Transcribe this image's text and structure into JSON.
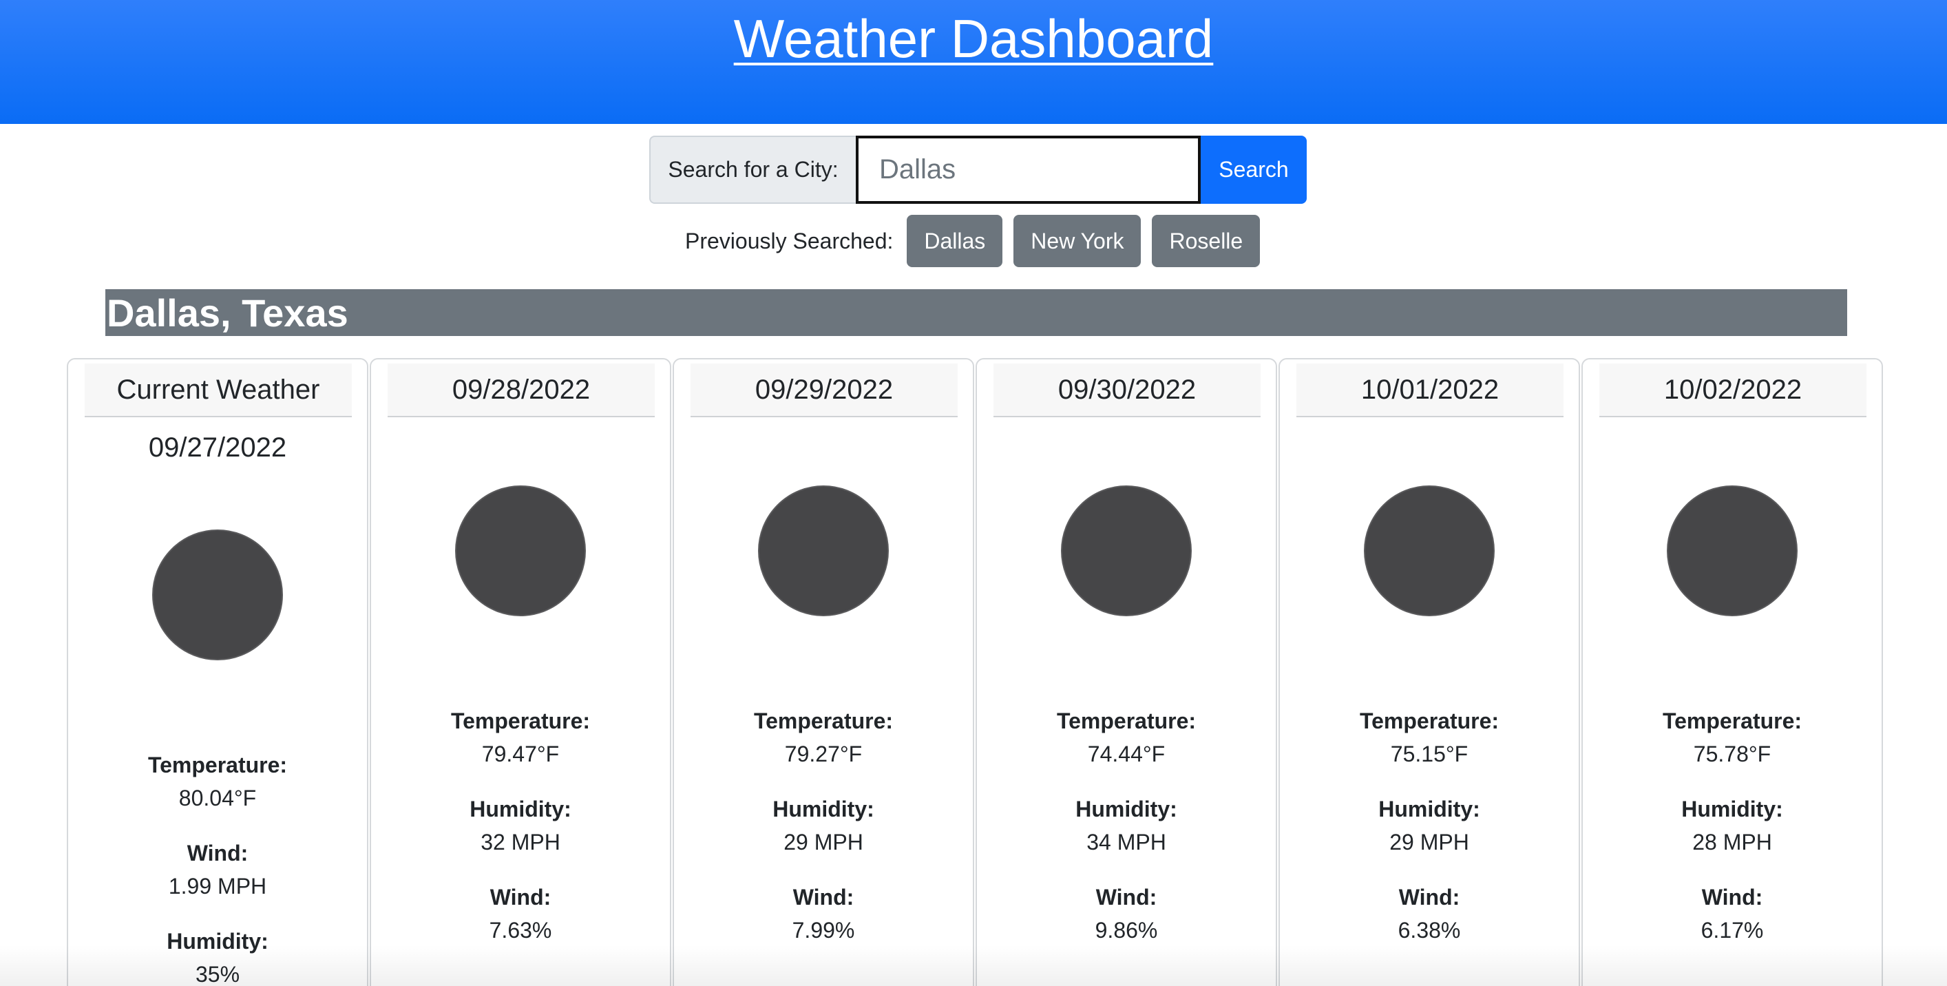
{
  "header": {
    "title": "Weather Dashboard"
  },
  "search": {
    "label": "Search for a City:",
    "value": "Dallas",
    "button_label": "Search"
  },
  "history": {
    "label": "Previously Searched:",
    "items": [
      "Dallas",
      "New York",
      "Roselle"
    ]
  },
  "city": {
    "name": "Dallas, Texas"
  },
  "current": {
    "header": "Current Weather",
    "date": "09/27/2022",
    "icon": "weather-icon",
    "temperature_label": "Temperature:",
    "temperature": "80.04°F",
    "wind_label": "Wind:",
    "wind": "1.99 MPH",
    "humidity_label": "Humidity:",
    "humidity": "35%"
  },
  "forecast": [
    {
      "date": "09/28/2022",
      "temperature_label": "Temperature:",
      "temperature": "79.47°F",
      "humidity_label": "Humidity:",
      "humidity": "32 MPH",
      "wind_label": "Wind:",
      "wind": "7.63%"
    },
    {
      "date": "09/29/2022",
      "temperature_label": "Temperature:",
      "temperature": "79.27°F",
      "humidity_label": "Humidity:",
      "humidity": "29 MPH",
      "wind_label": "Wind:",
      "wind": "7.99%"
    },
    {
      "date": "09/30/2022",
      "temperature_label": "Temperature:",
      "temperature": "74.44°F",
      "humidity_label": "Humidity:",
      "humidity": "34 MPH",
      "wind_label": "Wind:",
      "wind": "9.86%"
    },
    {
      "date": "10/01/2022",
      "temperature_label": "Temperature:",
      "temperature": "75.15°F",
      "humidity_label": "Humidity:",
      "humidity": "29 MPH",
      "wind_label": "Wind:",
      "wind": "6.38%"
    },
    {
      "date": "10/02/2022",
      "temperature_label": "Temperature:",
      "temperature": "75.78°F",
      "humidity_label": "Humidity:",
      "humidity": "28 MPH",
      "wind_label": "Wind:",
      "wind": "6.17%"
    }
  ],
  "colors": {
    "header_blue": "#0a6cf5",
    "primary_button": "#0d6efd",
    "secondary_gray": "#6c757d",
    "icon_dark": "#464648"
  }
}
